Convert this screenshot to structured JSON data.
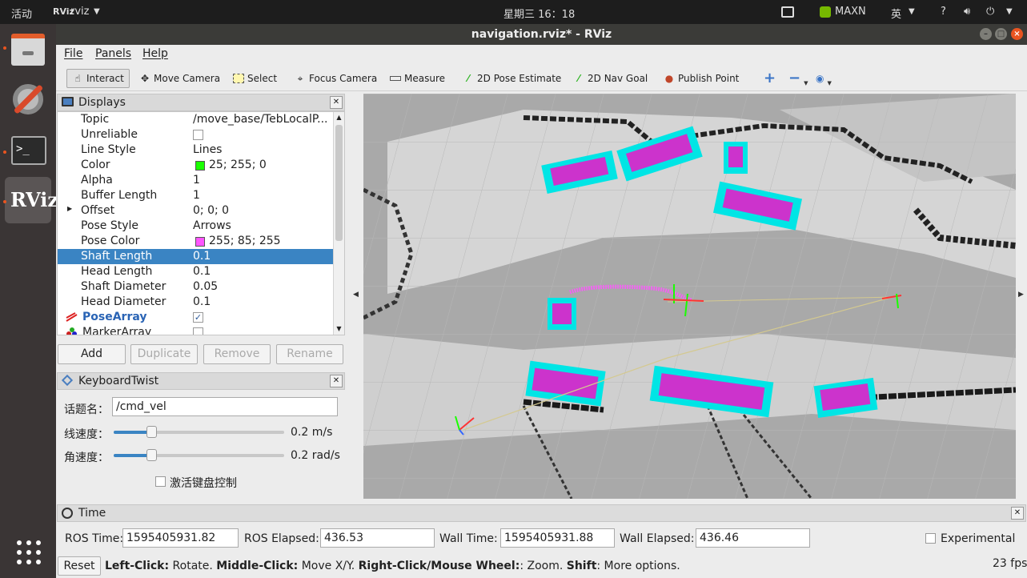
{
  "topbar": {
    "activities": "活动",
    "app_name": "rviz",
    "clock": "星期三 16：18",
    "power_mode": "MAXN",
    "input_method": "英"
  },
  "dock": {
    "rviz_label": "RViz"
  },
  "window": {
    "title": "navigation.rviz* - RViz"
  },
  "menu": {
    "file": "File",
    "panels": "Panels",
    "help": "Help"
  },
  "toolbar": {
    "interact": "Interact",
    "move_camera": "Move Camera",
    "select": "Select",
    "focus_camera": "Focus Camera",
    "measure": "Measure",
    "pose_estimate": "2D Pose Estimate",
    "nav_goal": "2D Nav Goal",
    "publish_point": "Publish Point"
  },
  "displays": {
    "title": "Displays",
    "rows": [
      {
        "key": "Topic",
        "value": "/move_base/TebLocalP..."
      },
      {
        "key": "Unreliable",
        "value": ""
      },
      {
        "key": "Line Style",
        "value": "Lines"
      },
      {
        "key": "Color",
        "value": "25; 255; 0"
      },
      {
        "key": "Alpha",
        "value": "1"
      },
      {
        "key": "Buffer Length",
        "value": "1"
      },
      {
        "key": "Offset",
        "value": "0; 0; 0"
      },
      {
        "key": "Pose Style",
        "value": "Arrows"
      },
      {
        "key": "Pose Color",
        "value": "255; 85; 255"
      },
      {
        "key": "Shaft Length",
        "value": "0.1"
      },
      {
        "key": "Head Length",
        "value": "0.1"
      },
      {
        "key": "Shaft Diameter",
        "value": "0.05"
      },
      {
        "key": "Head Diameter",
        "value": "0.1"
      },
      {
        "key": "PoseArray",
        "value": ""
      },
      {
        "key": "MarkerArray",
        "value": ""
      }
    ],
    "color_swatch": "#19ff00",
    "pose_color_swatch": "#ff55ff",
    "selected_row": "Shaft Length",
    "add": "Add",
    "duplicate": "Duplicate",
    "remove": "Remove",
    "rename": "Rename"
  },
  "keyboard": {
    "title": "KeyboardTwist",
    "topic_label": "话题名：",
    "topic_value": "/cmd_vel",
    "linear_label": "线速度：",
    "linear_value": "0.2 m/s",
    "linear_level": 0.22,
    "angular_label": "角速度：",
    "angular_value": "0.2 rad/s",
    "angular_level": 0.22,
    "activate_label": "激活键盘控制"
  },
  "time": {
    "title": "Time",
    "ros_time_label": "ROS Time:",
    "ros_time": "1595405931.82",
    "ros_elapsed_label": "ROS Elapsed:",
    "ros_elapsed": "436.53",
    "wall_time_label": "Wall Time:",
    "wall_time": "1595405931.88",
    "wall_elapsed_label": "Wall Elapsed:",
    "wall_elapsed": "436.46",
    "experimental": "Experimental"
  },
  "status": {
    "reset": "Reset",
    "left_click": "Left-Click:",
    "left_desc": " Rotate. ",
    "middle_click": "Middle-Click:",
    "middle_desc": " Move X/Y. ",
    "right_click": "Right-Click/Mouse Wheel:",
    "right_desc": ": Zoom. ",
    "shift": "Shift",
    "shift_desc": ": More options.",
    "fps": "23 fps"
  }
}
